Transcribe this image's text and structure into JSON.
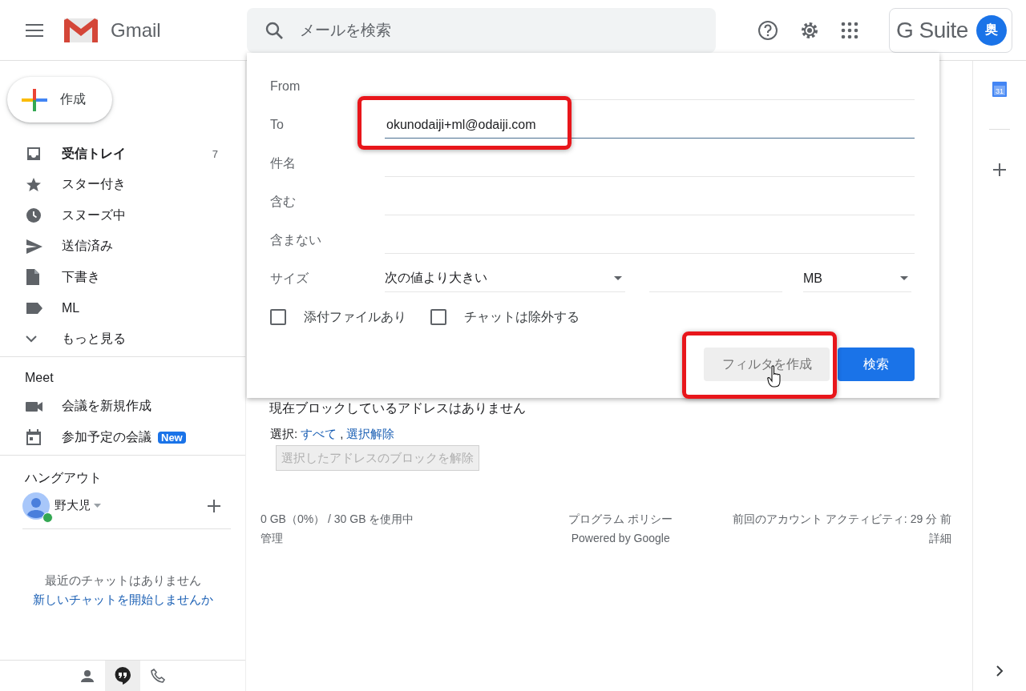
{
  "header": {
    "app_name": "Gmail",
    "search_placeholder": "メールを検索",
    "brand": "G Suite",
    "avatar_initial": "奥"
  },
  "rail": {
    "calendar_day": "31"
  },
  "compose": "作成",
  "nav": [
    {
      "label": "受信トレイ",
      "count": "7",
      "unread": true
    },
    {
      "label": "スター付き",
      "unread": false
    },
    {
      "label": "スヌーズ中",
      "unread": false
    },
    {
      "label": "送信済み",
      "unread": false
    },
    {
      "label": "下書き",
      "unread": false
    },
    {
      "label": "ML",
      "unread": false
    },
    {
      "label": "もっと見る",
      "unread": false
    }
  ],
  "meet": {
    "title": "Meet",
    "items": [
      {
        "label": "会議を新規作成"
      },
      {
        "label": "参加予定の会議",
        "badge": "New"
      }
    ]
  },
  "hangouts": {
    "title": "ハングアウト",
    "user": "野大児",
    "online": true,
    "empty_text": "最近のチャットはありません",
    "start_link": "新しいチャットを開始しませんか"
  },
  "bottom_tabs": [
    {
      "selected": false
    },
    {
      "selected": true
    },
    {
      "selected": false
    }
  ],
  "search_dialog": {
    "fields": [
      {
        "label": "From",
        "focused": false,
        "highlighted": false
      },
      {
        "label": "To",
        "value": "okunodaiji+ml@odaiji.com",
        "focused": true,
        "highlighted": true
      },
      {
        "label": "件名",
        "focused": false,
        "highlighted": false
      },
      {
        "label": "含む",
        "focused": false,
        "highlighted": false
      },
      {
        "label": "含まない",
        "focused": false,
        "highlighted": false
      }
    ],
    "size": {
      "label": "サイズ",
      "comparator": "次の値より大きい",
      "unit": "MB"
    },
    "checkboxes": [
      {
        "label": "添付ファイルあり",
        "checked": false
      },
      {
        "label": "チャットは除外する",
        "checked": false
      }
    ],
    "create_filter": {
      "label": "フィルタを作成",
      "highlighted": true
    },
    "search_button": "検索"
  },
  "main": {
    "blocked_text": "現在ブロックしているアドレスはありません",
    "select_label": "選択:",
    "select_links": [
      "すべて",
      "選択解除"
    ],
    "separator": ",",
    "unblock_button": {
      "label": "選択したアドレスのブロックを解除",
      "disabled": true
    }
  },
  "footer": {
    "storage": "0 GB（0%） / 30 GB を使用中",
    "manage": "管理",
    "policy": "プログラム ポリシー",
    "powered": "Powered by Google",
    "activity": "前回のアカウント アクティビティ: 29 分 前",
    "details": "詳細"
  }
}
